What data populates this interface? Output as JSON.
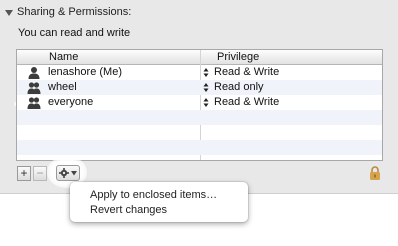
{
  "section": {
    "title": "Sharing & Permissions:"
  },
  "status_text": "You can read and write",
  "table": {
    "columns": [
      "Name",
      "Privilege"
    ],
    "rows": [
      {
        "name": "lenashore (Me)",
        "privilege": "Read & Write",
        "icon": "user-icon"
      },
      {
        "name": "wheel",
        "privilege": "Read only",
        "icon": "group-icon"
      },
      {
        "name": "everyone",
        "privilege": "Read & Write",
        "icon": "group-icon"
      }
    ]
  },
  "toolbar": {
    "add_label": "+",
    "remove_label": "−"
  },
  "action_menu": {
    "items": [
      "Apply to enclosed items…",
      "Revert changes"
    ]
  }
}
